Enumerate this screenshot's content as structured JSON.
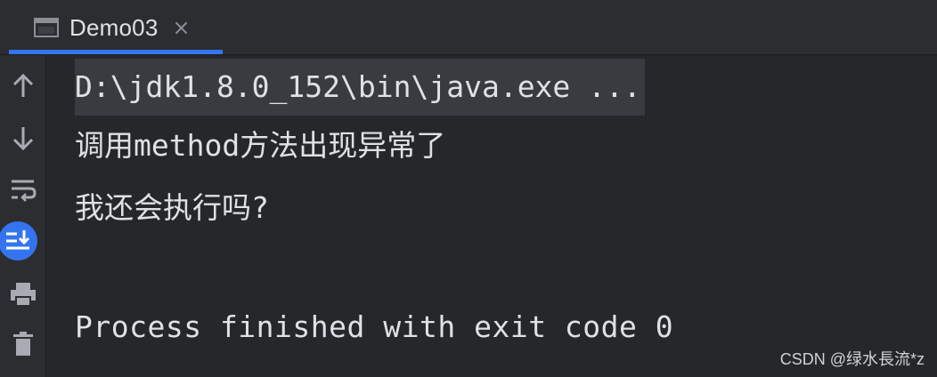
{
  "tab": {
    "label": "Demo03",
    "close_glyph": "×",
    "icon": "console-window-icon"
  },
  "toolbar": {
    "items": [
      {
        "icon": "arrow-up-icon"
      },
      {
        "icon": "arrow-down-icon"
      },
      {
        "icon": "soft-wrap-icon"
      },
      {
        "icon": "scroll-to-end-icon",
        "active": true
      },
      {
        "icon": "print-icon"
      },
      {
        "icon": "trash-icon"
      }
    ]
  },
  "console": {
    "command": "D:\\jdk1.8.0_152\\bin\\java.exe ...",
    "output_1": "调用method方法出现异常了",
    "output_2": "我还会执行吗?",
    "exit": "Process finished with exit code 0"
  },
  "watermark": "CSDN @绿水長流*z",
  "colors": {
    "background": "#2b2d30",
    "console_bg": "#25272b",
    "text": "#dfe1e5",
    "accent": "#3574f0",
    "command_highlight": "#393b40"
  }
}
